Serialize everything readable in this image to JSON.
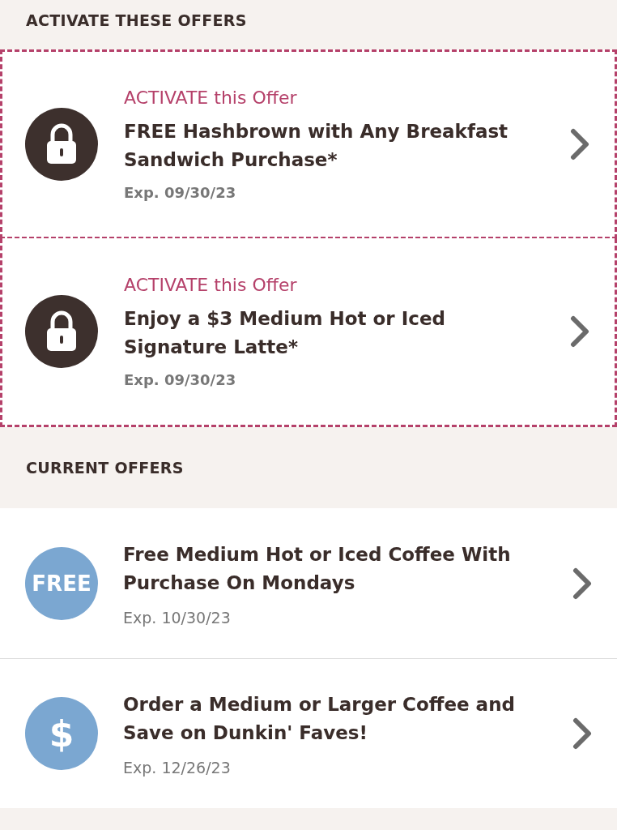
{
  "activate_section": {
    "heading": "ACTIVATE THESE OFFERS",
    "offers": [
      {
        "kind": "locked",
        "action": "ACTIVATE this Offer",
        "title": "FREE Hashbrown with Any Breakfast Sandwich Purchase*",
        "expiry": "Exp. 09/30/23"
      },
      {
        "kind": "locked",
        "action": "ACTIVATE this Offer",
        "title": "Enjoy a $3 Medium Hot or Iced Signature Latte*",
        "expiry": "Exp. 09/30/23"
      }
    ]
  },
  "current_section": {
    "heading": "CURRENT OFFERS",
    "offers": [
      {
        "kind": "badge",
        "badge": "FREE",
        "title": "Free Medium Hot or Iced Coffee With Purchase On Mondays",
        "expiry": "Exp. 10/30/23"
      },
      {
        "kind": "badge",
        "badge": "$",
        "title": "Order a Medium or Larger Coffee and Save on Dunkin' Faves!",
        "expiry": "Exp. 12/26/23"
      }
    ]
  }
}
